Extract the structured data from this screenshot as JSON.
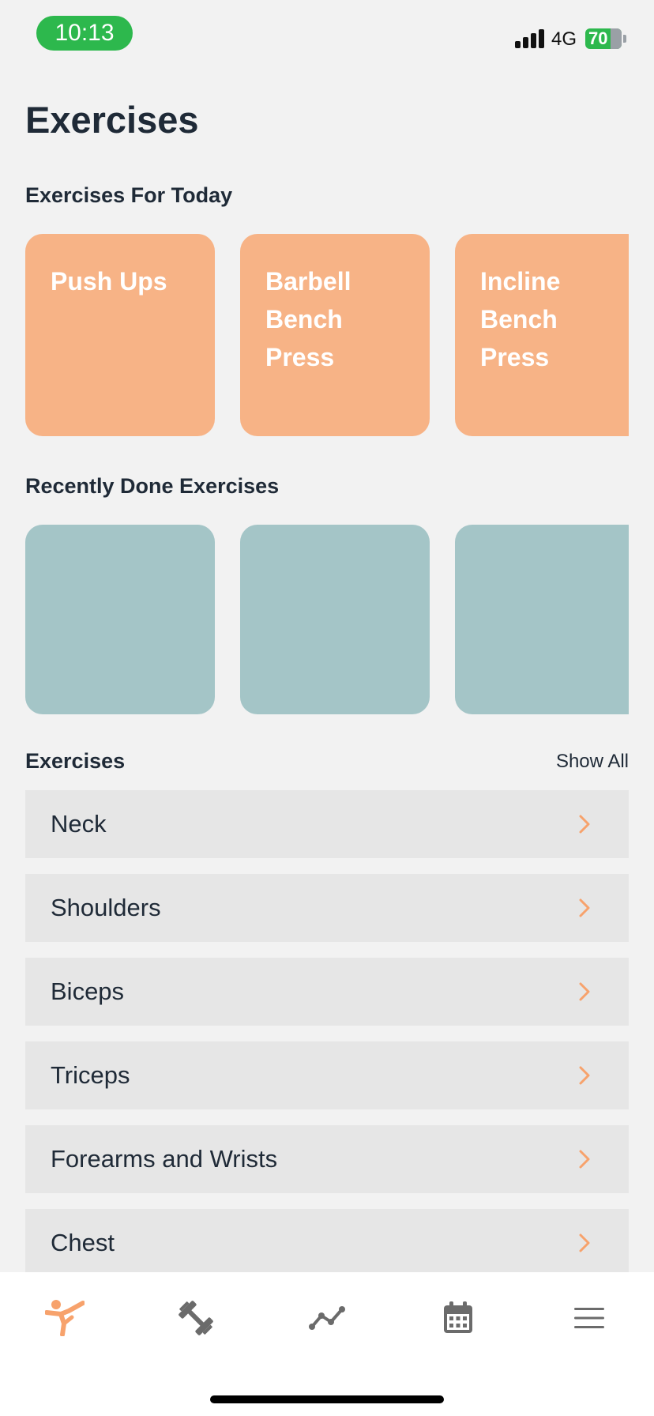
{
  "status_bar": {
    "time": "10:13",
    "network": "4G",
    "battery": "70"
  },
  "page_title": "Exercises",
  "today": {
    "title": "Exercises For Today",
    "cards": [
      {
        "label": "Push Ups"
      },
      {
        "label": "Barbell Bench Press"
      },
      {
        "label": "Incline Bench Press"
      }
    ]
  },
  "recent": {
    "title": "Recently Done Exercises",
    "cards": [
      {},
      {},
      {}
    ]
  },
  "exercises": {
    "title": "Exercises",
    "show_all": "Show All",
    "items": [
      {
        "label": "Neck"
      },
      {
        "label": "Shoulders"
      },
      {
        "label": "Biceps"
      },
      {
        "label": "Triceps"
      },
      {
        "label": "Forearms and Wrists"
      },
      {
        "label": "Chest"
      }
    ]
  },
  "tab_bar": {
    "tabs": [
      {
        "icon": "stretching-person-icon",
        "active": true
      },
      {
        "icon": "dumbbell-icon",
        "active": false
      },
      {
        "icon": "progress-line-icon",
        "active": false
      },
      {
        "icon": "calendar-icon",
        "active": false
      },
      {
        "icon": "menu-icon",
        "active": false
      }
    ]
  },
  "colors": {
    "accent": "#f7a26c",
    "today_card": "#f7b386",
    "recent_card": "#a4c5c7",
    "list_item": "#e6e6e6",
    "time_pill": "#2db84d",
    "inactive_icon": "#6b6b6b"
  }
}
